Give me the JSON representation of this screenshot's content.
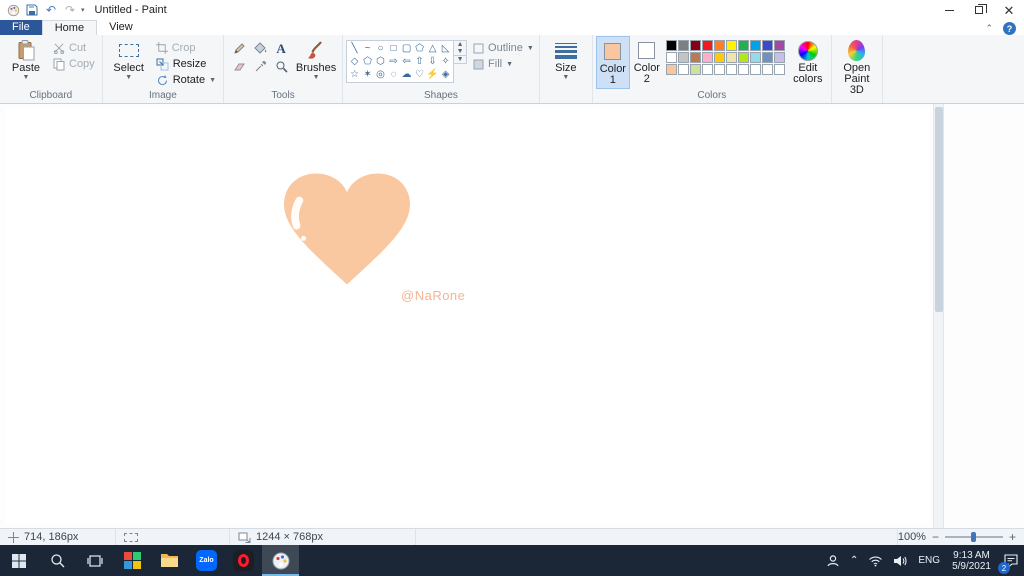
{
  "titlebar": {
    "title": "Untitled - Paint"
  },
  "tabs": {
    "file": "File",
    "home": "Home",
    "view": "View"
  },
  "ribbon": {
    "clipboard": {
      "label": "Clipboard",
      "paste": "Paste",
      "cut": "Cut",
      "copy": "Copy"
    },
    "image": {
      "label": "Image",
      "select": "Select",
      "crop": "Crop",
      "resize": "Resize",
      "rotate": "Rotate"
    },
    "tools": {
      "label": "Tools",
      "brushes": "Brushes",
      "names": [
        "pencil",
        "fill-with-color",
        "text",
        "eraser",
        "color-picker",
        "magnifier"
      ]
    },
    "shapes": {
      "label": "Shapes",
      "outline": "Outline",
      "fill": "Fill",
      "names": [
        "line",
        "curve",
        "oval",
        "rectangle",
        "rounded-rectangle",
        "polygon",
        "triangle",
        "right-triangle",
        "diamond",
        "pentagon",
        "hexagon",
        "right-arrow",
        "left-arrow",
        "up-arrow",
        "down-arrow",
        "four-point-star",
        "five-point-star",
        "six-point-star",
        "rounded-callout",
        "oval-callout",
        "cloud-callout",
        "heart",
        "lightning",
        "diamond-alt"
      ],
      "glyphs": [
        "╲",
        "~",
        "○",
        "□",
        "▢",
        "⬠",
        "△",
        "◺",
        "◇",
        "⬠",
        "⬡",
        "⇨",
        "⇦",
        "⇧",
        "⇩",
        "✧",
        "☆",
        "✶",
        "◎",
        "◌",
        "☁",
        "♡",
        "⚡",
        "◈"
      ]
    },
    "size": {
      "label": "Size"
    },
    "colors": {
      "label": "Colors",
      "color1_label": "Color 1",
      "color2_label": "Color 2",
      "edit_colors": "Edit colors",
      "color1": "#f8c7a1",
      "color2": "#ffffff",
      "palette": [
        "#000000",
        "#7f7f7f",
        "#880015",
        "#ed1c24",
        "#ff7f27",
        "#fff200",
        "#22b14c",
        "#00a2e8",
        "#3f48cc",
        "#a349a4",
        "#ffffff",
        "#c3c3c3",
        "#b97a57",
        "#ffaec9",
        "#ffc90e",
        "#efe4b0",
        "#b5e61d",
        "#99d9ea",
        "#7092be",
        "#c8bfe7",
        "#f8c7a1",
        "#ffffff",
        "#cfe0a5",
        "#ffffff",
        "#ffffff",
        "#ffffff",
        "#ffffff",
        "#ffffff",
        "#ffffff",
        "#ffffff"
      ]
    },
    "paint3d": {
      "label": "Open Paint 3D"
    }
  },
  "canvas": {
    "heart_color": "#f9c7a0",
    "watermark": "@NaRone",
    "watermark_color": "#f5b494"
  },
  "statusbar": {
    "cursor_pos": "714, 186px",
    "canvas_size": "1244 × 768px",
    "zoom": "100%"
  },
  "taskbar": {
    "language": "ENG",
    "time": "9:13 AM",
    "date": "5/9/2021",
    "notification_count": "2",
    "zalo_label": "Zalo",
    "apps": [
      "colored-grid-app",
      "file-explorer",
      "zalo",
      "opera",
      "paint"
    ]
  }
}
